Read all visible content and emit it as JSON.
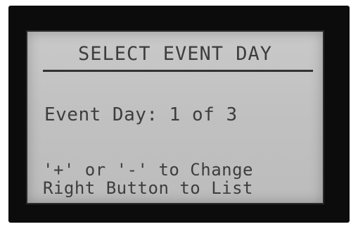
{
  "display": {
    "title": "SELECT EVENT DAY",
    "event_day_line": "Event Day: 1 of 3",
    "help_line_1": "'+' or '-' to Change",
    "help_line_2": "Right Button to List"
  },
  "colors": {
    "bezel": "#0c0c0c",
    "lcd_background": "#c4c4c4",
    "lcd_text": "#3d3d3d"
  }
}
